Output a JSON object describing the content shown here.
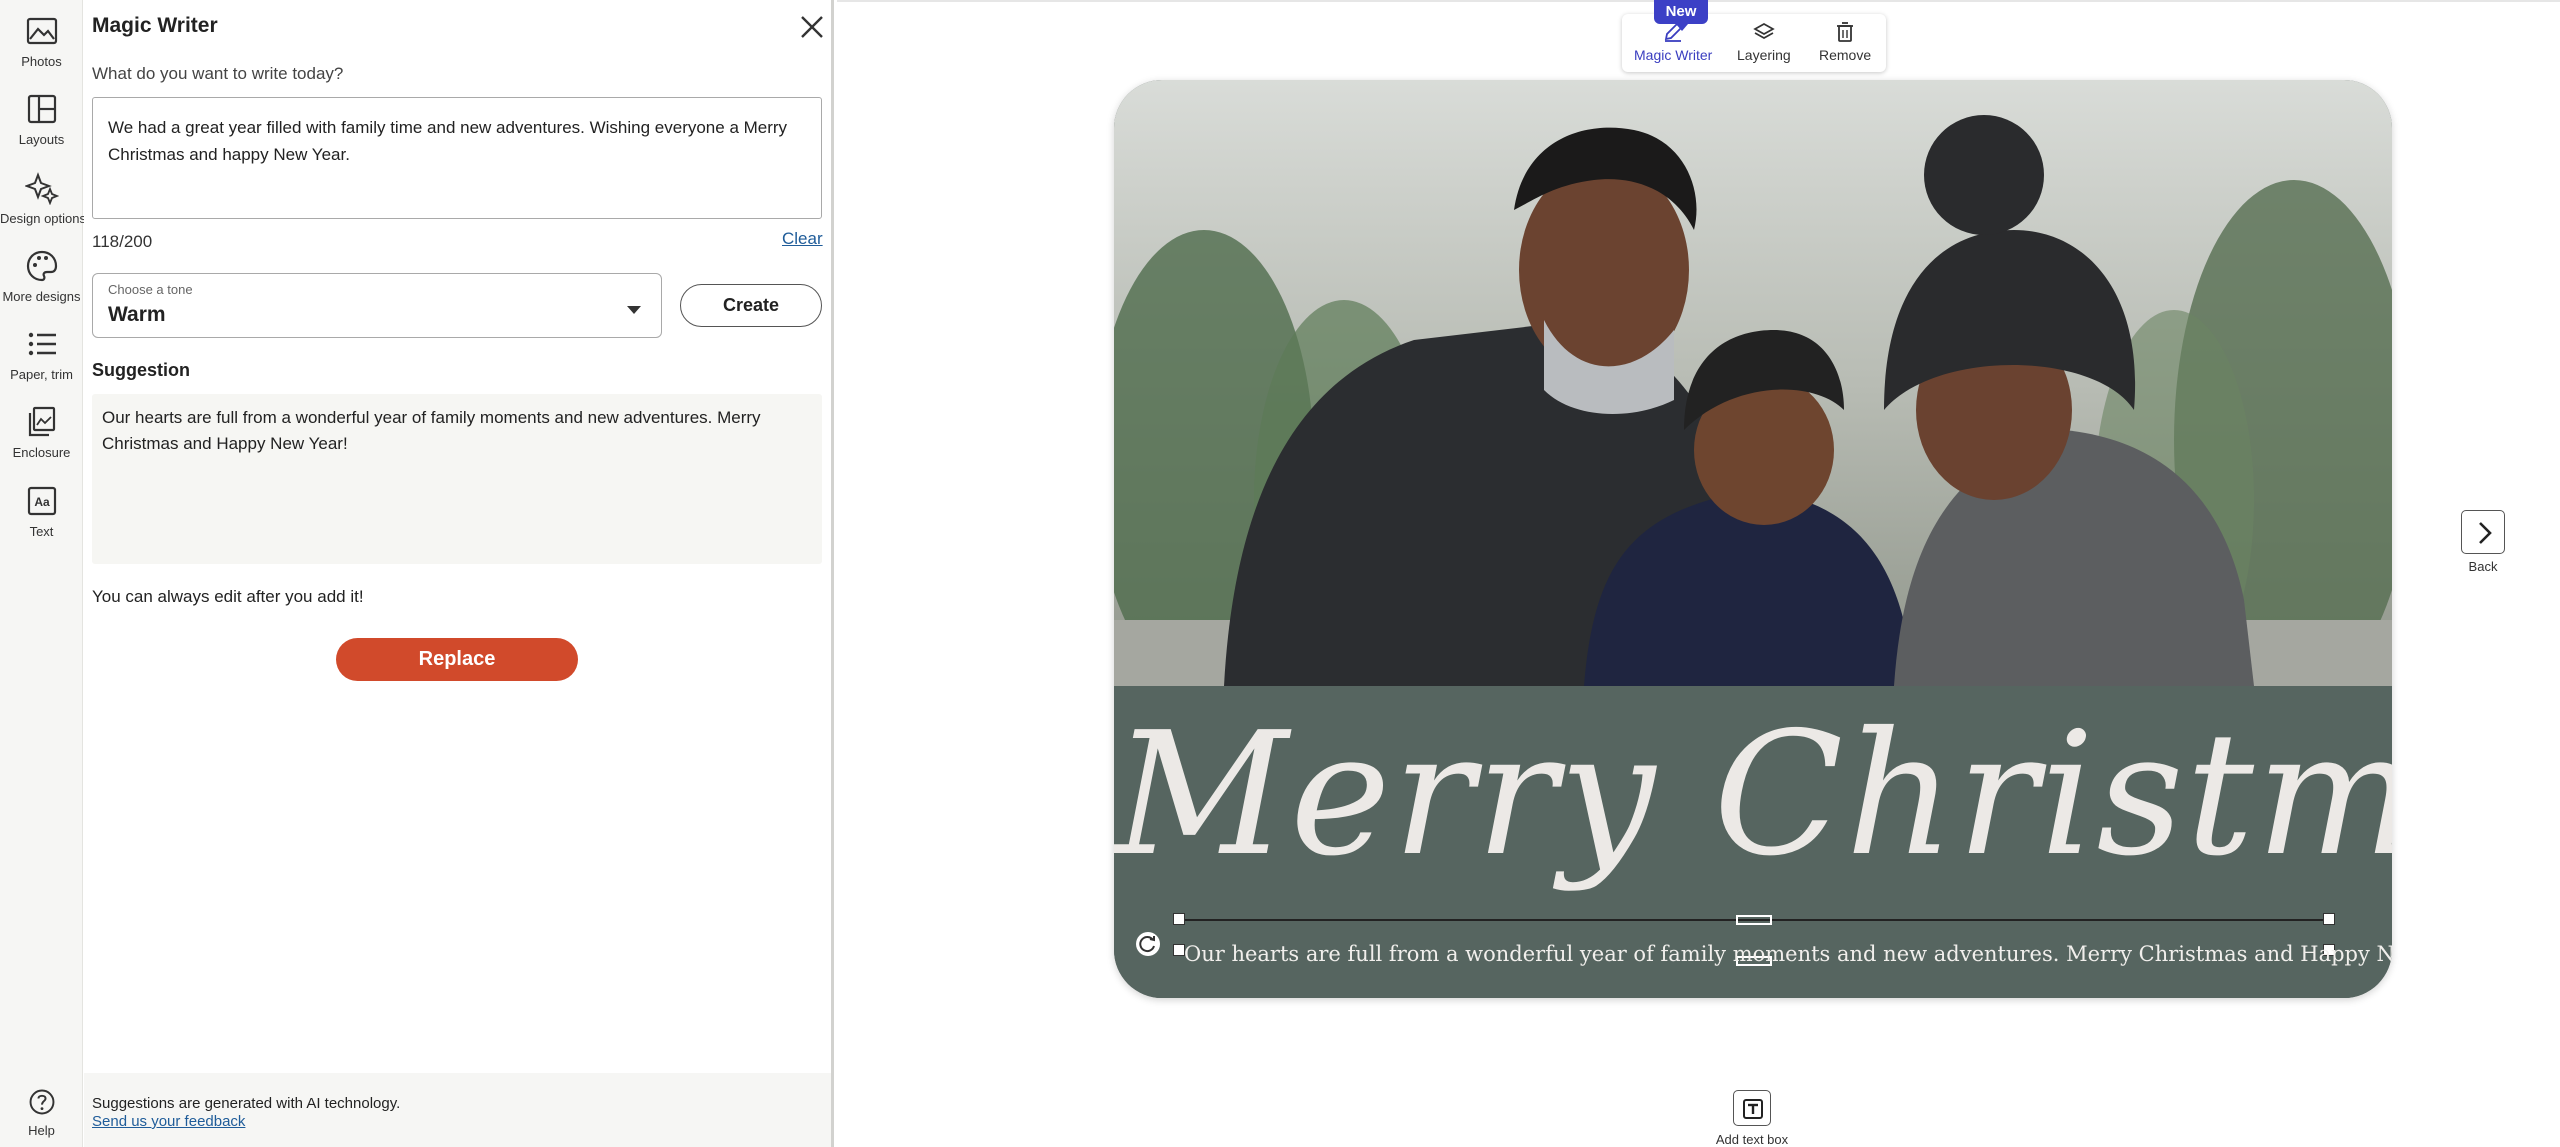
{
  "rail": {
    "items": [
      {
        "label": "Photos",
        "icon": "photos-icon"
      },
      {
        "label": "Layouts",
        "icon": "layouts-icon"
      },
      {
        "label": "Design options",
        "icon": "design-options-icon"
      },
      {
        "label": "More designs",
        "icon": "more-designs-icon"
      },
      {
        "label": "Paper, trim",
        "icon": "paper-trim-icon"
      },
      {
        "label": "Enclosure",
        "icon": "enclosure-icon"
      },
      {
        "label": "Text",
        "icon": "text-icon"
      }
    ],
    "help_label": "Help"
  },
  "panel": {
    "title": "Magic Writer",
    "prompt_label": "What do you want to write today?",
    "prompt_value": "We had a great year filled with family time and new adventures. Wishing everyone a Merry Christmas and happy New Year.",
    "counter": "118/200",
    "clear_label": "Clear",
    "tone_label": "Choose a tone",
    "tone_value": "Warm",
    "create_label": "Create",
    "suggestion_label": "Suggestion",
    "suggestion_text": "Our hearts are full from a wonderful year of family moments and new adventures. Merry Christmas and Happy New Year!",
    "edit_note": "You can always edit after you add it!",
    "replace_label": "Replace",
    "ai_note": "Suggestions are generated with AI technology.",
    "feedback_label": "Send us your feedback"
  },
  "toolbar": {
    "badge": "New",
    "magic_writer": "Magic Writer",
    "layering": "Layering",
    "remove": "Remove"
  },
  "card": {
    "headline": "Merry Christmas",
    "message": "Our hearts are full from a wonderful year of family moments and new adventures. Merry Christmas and Happy New Year!"
  },
  "nav": {
    "next_label": "Back",
    "add_text_label": "Add text box"
  },
  "colors": {
    "accent": "#3c40c6",
    "replace": "#d14a2b",
    "banner": "#566560"
  }
}
